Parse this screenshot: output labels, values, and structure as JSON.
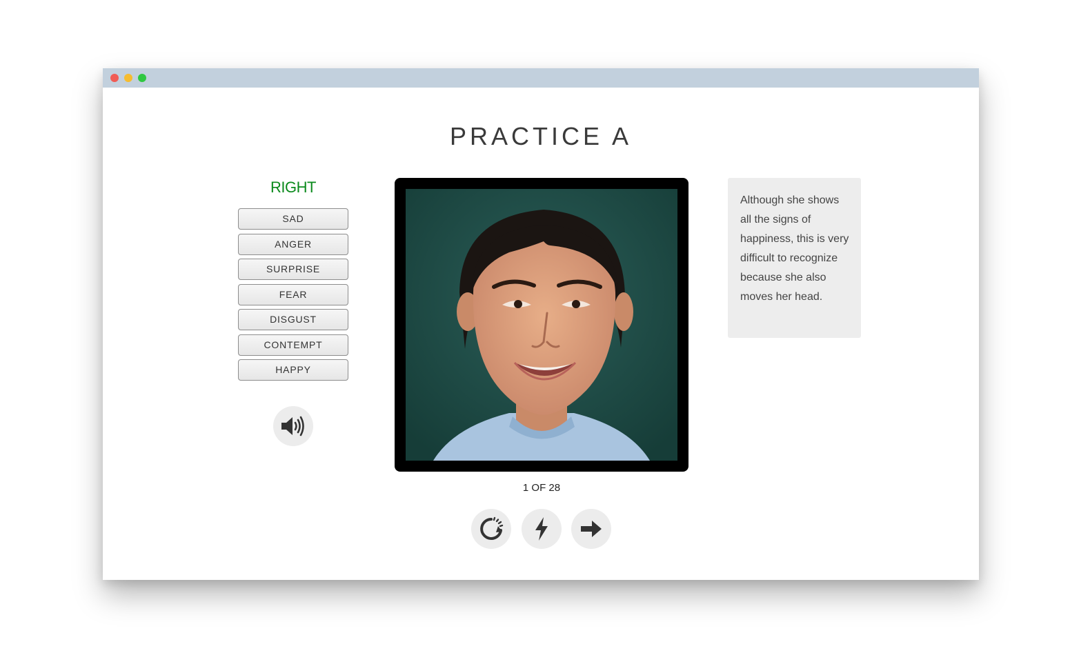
{
  "window": {
    "controls": [
      "close",
      "minimize",
      "maximize"
    ]
  },
  "page": {
    "title": "PRACTICE A"
  },
  "answer": {
    "result": "RIGHT",
    "result_color": "#0b8a1c",
    "options": [
      "SAD",
      "ANGER",
      "SURPRISE",
      "FEAR",
      "DISGUST",
      "CONTEMPT",
      "HAPPY"
    ]
  },
  "sound": {
    "icon": "speaker-icon"
  },
  "photo": {
    "subject": "smiling woman face"
  },
  "progress": {
    "current": 1,
    "total": 28,
    "label": "1 OF 28"
  },
  "controls": {
    "replay_icon": "replay-icon",
    "flash_icon": "lightning-icon",
    "next_icon": "arrow-right-icon"
  },
  "feedback": {
    "text": "Although she shows all the signs of happiness, this is very difficult to recognize because she also moves her head."
  }
}
